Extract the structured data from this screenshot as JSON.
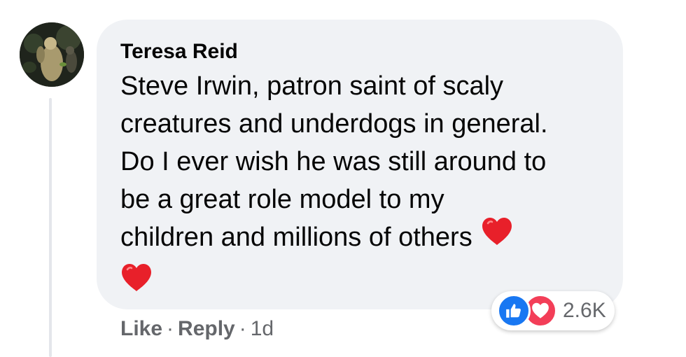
{
  "comment": {
    "author": "Teresa Reid",
    "text_lines": [
      "Steve Irwin, patron saint of scaly",
      "creatures and underdogs in general.",
      "Do I ever wish he was still around to",
      "be a great role model to my",
      "children and millions of others"
    ],
    "emoji": "red-heart"
  },
  "actions": {
    "like": "Like",
    "separator": "·",
    "reply": "Reply",
    "time": "1d"
  },
  "reactions": {
    "types": [
      "like-icon",
      "love-icon"
    ],
    "count": "2.6K",
    "colors": {
      "like": "#1877f2",
      "love": "#f33e58"
    }
  },
  "colors": {
    "bubble": "#f0f2f5",
    "text": "#050505",
    "secondary_text": "#65676b",
    "heart": "#e8202a"
  }
}
